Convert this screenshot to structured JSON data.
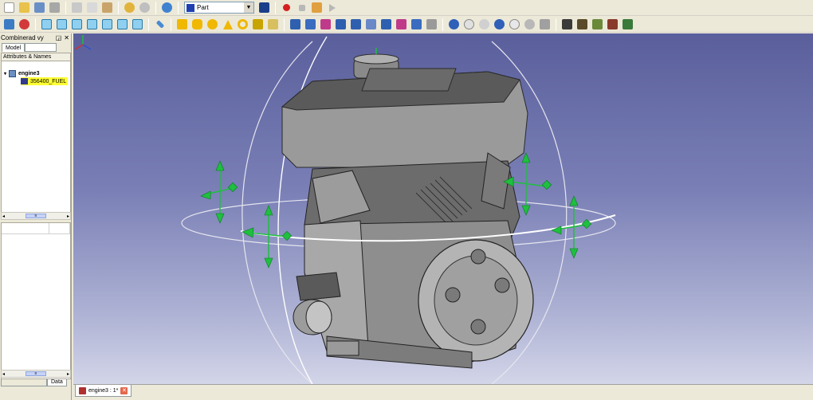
{
  "toolbar": {
    "row1_icons": [
      "new-icon",
      "open-icon",
      "save-icon",
      "print-icon",
      "cut-icon",
      "copy-icon",
      "paste-icon",
      "undo-icon",
      "redo-icon",
      "refresh-icon"
    ],
    "workbench_label": "Part",
    "row1_tail_icons": [
      "whats-this-icon",
      "record-macro-icon",
      "stop-macro-icon",
      "edit-macro-icon",
      "run-macro-icon"
    ],
    "row2_icons": [
      "fit-all-icon",
      "draw-style-icon",
      "isometric-view-icon",
      "front-view-icon",
      "top-view-icon",
      "right-view-icon",
      "rear-view-icon",
      "bottom-view-icon",
      "left-view-icon",
      "measure-icon",
      "box-icon",
      "cylinder-icon",
      "sphere-icon",
      "cone-icon",
      "torus-icon",
      "primitives-icon",
      "shape-builder-icon",
      "extrude-icon",
      "revolve-icon",
      "mirror-icon",
      "fillet-icon",
      "chamfer-icon",
      "ruled-surface-icon",
      "loft-icon",
      "sweep-icon",
      "section-icon",
      "cross-section-icon",
      "boolean-icon",
      "cut-icon",
      "fuse-icon",
      "common-icon",
      "compound-icon",
      "explode-icon",
      "check-geometry-icon",
      "edit-tool-icon",
      "transform-icon",
      "placement-icon",
      "view-tool-icon",
      "color-tool-icon"
    ]
  },
  "combo": {
    "title": "Combinerad vy",
    "controls": [
      "◲",
      "✕"
    ],
    "tab_model": "Model",
    "tree_header": "Attributes & Names",
    "document_name": "engine3",
    "object_name": "356400_FUEL",
    "tab_data": "Data"
  },
  "scroll": {
    "thumb_glyph": "≡",
    "left": "◂",
    "right": "▸"
  },
  "view": {
    "background_top": "#5a5f9c",
    "background_bottom": "#d3d5e8",
    "dragger_color": "#1fbf3f"
  },
  "mdi": {
    "tab_label": "engine3 : 1*",
    "close_glyph": "✕"
  }
}
